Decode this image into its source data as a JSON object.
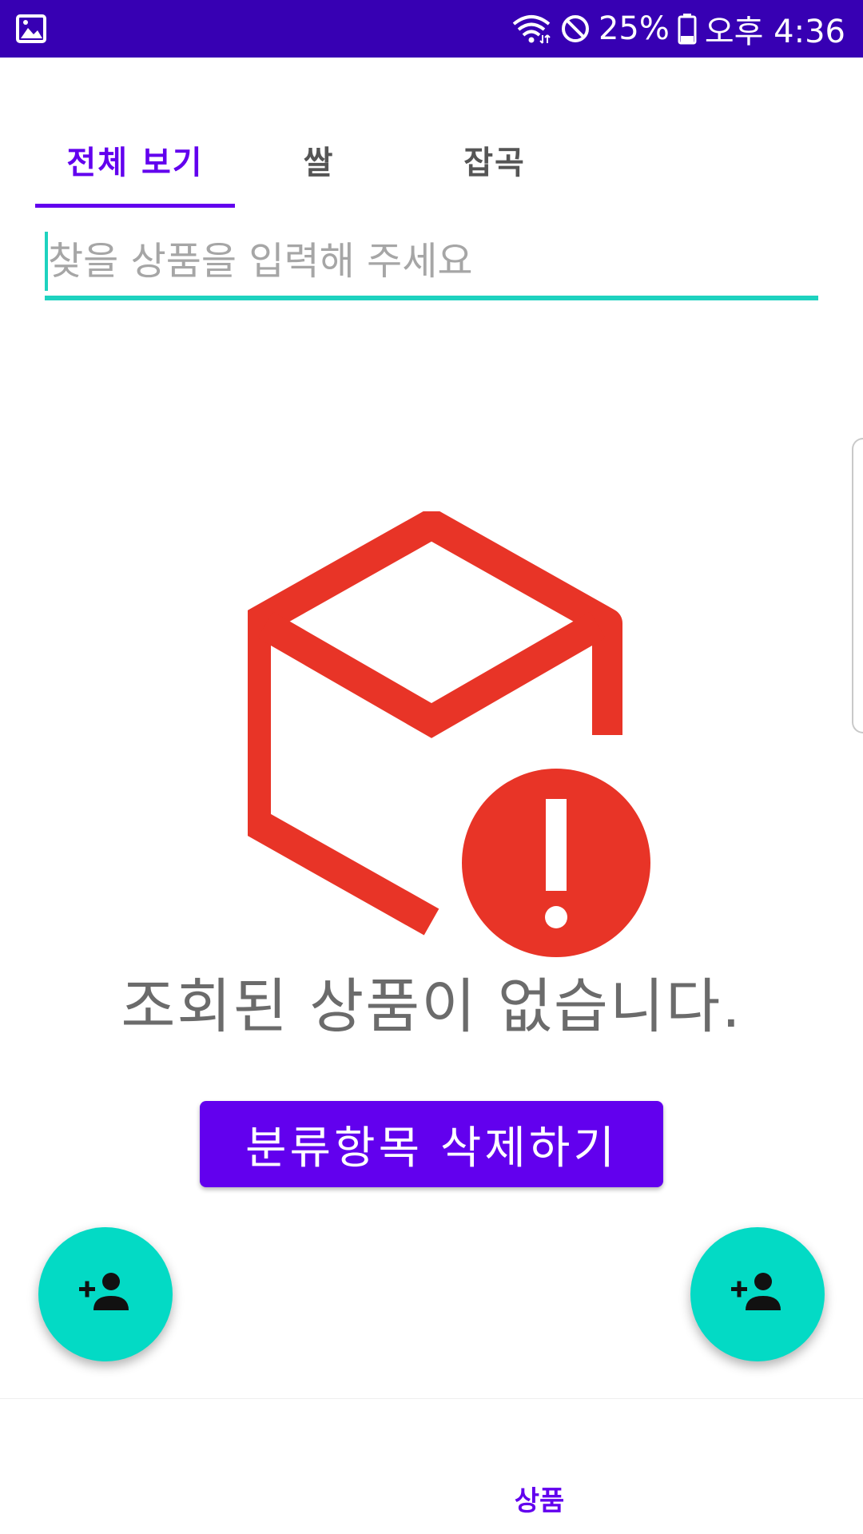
{
  "status_bar": {
    "battery": "25%",
    "time": "오후 4:36",
    "icons": [
      "gallery-icon",
      "wifi-icon",
      "do-not-disturb-icon",
      "battery-icon"
    ]
  },
  "tabs": [
    {
      "label": "전체 보기",
      "active": true
    },
    {
      "label": "쌀",
      "active": false
    },
    {
      "label": "잡곡",
      "active": false
    }
  ],
  "search": {
    "value": "",
    "placeholder": "찾을 상품을 입력해 주세요"
  },
  "empty_state": {
    "icon": "box-error-icon",
    "message": "조회된 상품이 없습니다."
  },
  "actions": {
    "delete_category_label": "분류항목 삭제하기"
  },
  "fabs": [
    {
      "icon": "add-person-icon"
    },
    {
      "icon": "add-person-icon"
    }
  ],
  "bottom_nav": {
    "items": [
      {
        "label": "상품",
        "active": true
      }
    ]
  },
  "colors": {
    "status_bar": "#3700b3",
    "primary": "#6200ee",
    "accent": "#03dac5",
    "error": "#e83427"
  }
}
